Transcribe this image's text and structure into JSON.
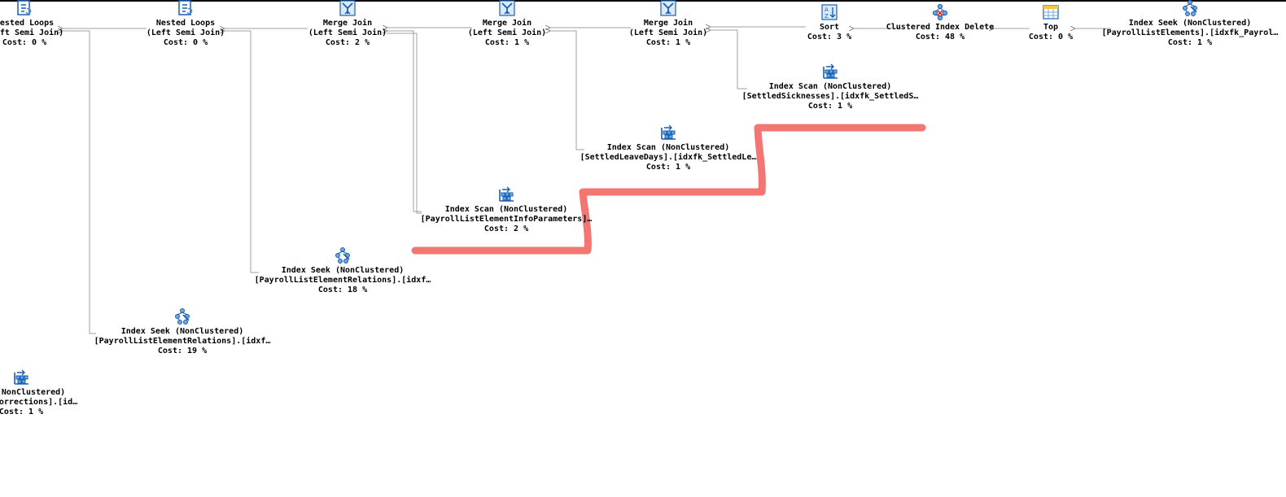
{
  "colors": {
    "edge": "#909090",
    "highlight": "#f37672",
    "icon_blue": "#1a5fb4",
    "icon_light": "#6fa8dc"
  },
  "nodes": [
    {
      "id": "n0",
      "icon": "nested-loops-icon",
      "line1": "Nested Loops",
      "line2": "(Left Semi Join)",
      "cost": "Cost: 0 %"
    },
    {
      "id": "n1",
      "icon": "nested-loops-icon",
      "line1": "Nested Loops",
      "line2": "(Left Semi Join)",
      "cost": "Cost: 0 %"
    },
    {
      "id": "n2",
      "icon": "merge-join-icon",
      "line1": "Merge Join",
      "line2": "(Left Semi Join)",
      "cost": "Cost: 2 %"
    },
    {
      "id": "n3",
      "icon": "merge-join-icon",
      "line1": "Merge Join",
      "line2": "(Left Semi Join)",
      "cost": "Cost: 1 %"
    },
    {
      "id": "n4",
      "icon": "merge-join-icon",
      "line1": "Merge Join",
      "line2": "(Left Semi Join)",
      "cost": "Cost: 1 %"
    },
    {
      "id": "n5",
      "icon": "sort-icon",
      "line1": "Sort",
      "line2": "",
      "cost": "Cost: 3 %"
    },
    {
      "id": "n6",
      "icon": "clustered-index-delete-icon",
      "line1": "Clustered Index Delete",
      "line2": "",
      "cost": "Cost: 48 %"
    },
    {
      "id": "n7",
      "icon": "top-icon",
      "line1": "Top",
      "line2": "",
      "cost": "Cost: 0 %"
    },
    {
      "id": "n8",
      "icon": "index-seek-icon",
      "line1": "Index Seek (NonClustered)",
      "line2": "[PayrollListElements].[idxfk_Payrol…",
      "cost": "Cost: 1 %"
    },
    {
      "id": "n9",
      "icon": "index-scan-icon",
      "line1": "Index Scan (NonClustered)",
      "line2": "[SettledSicknesses].[idxfk_SettledS…",
      "cost": "Cost: 1 %"
    },
    {
      "id": "n10",
      "icon": "index-scan-icon",
      "line1": "Index Scan (NonClustered)",
      "line2": "[SettledLeaveDays].[idxfk_SettledLe…",
      "cost": "Cost: 1 %"
    },
    {
      "id": "n11",
      "icon": "index-scan-icon",
      "line1": "Index Scan (NonClustered)",
      "line2": "[PayrollListElementInfoParameters]…",
      "cost": "Cost: 2 %"
    },
    {
      "id": "n12",
      "icon": "index-seek-icon",
      "line1": "Index Seek (NonClustered)",
      "line2": "[PayrollListElementRelations].[idxf…",
      "cost": "Cost: 18 %"
    },
    {
      "id": "n13",
      "icon": "index-seek-icon",
      "line1": "Index Seek (NonClustered)",
      "line2": "[PayrollListElementRelations].[idxf…",
      "cost": "Cost: 19 %"
    },
    {
      "id": "n14",
      "icon": "index-scan-icon",
      "line1": "can (NonClustered)",
      "line2": "lementCorrections].[id…",
      "cost": "Cost: 1 %"
    }
  ]
}
